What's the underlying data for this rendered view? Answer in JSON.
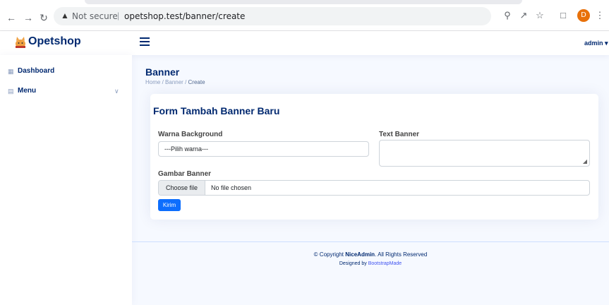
{
  "browser": {
    "security_label": "Not secure",
    "separator": "|",
    "url": "opetshop.test/banner/create",
    "profile_initial": "D",
    "icons": [
      "back-icon",
      "forward-icon",
      "reload-icon",
      "warning-icon",
      "zoom-icon",
      "share-icon",
      "star-icon",
      "sidepanel-icon",
      "menu-dots-icon"
    ]
  },
  "header": {
    "app_name": "Opetshop",
    "user": "admin"
  },
  "sidebar": {
    "items": [
      {
        "label": "Dashboard",
        "icon": "grid-icon"
      },
      {
        "label": "Menu",
        "icon": "menu-list-icon",
        "has_chevron": true
      }
    ]
  },
  "page": {
    "title": "Banner",
    "breadcrumb": [
      "Home",
      "Banner",
      "Create"
    ]
  },
  "form": {
    "title": "Form Tambah Banner Baru",
    "color_label": "Warna Background",
    "color_selected": "---Pilih warna---",
    "text_label": "Text Banner",
    "text_value": "",
    "image_label": "Gambar Banner",
    "file_button": "Choose file",
    "file_status": "No file chosen",
    "submit": "Kirim"
  },
  "footer": {
    "copy_prefix": "© Copyright",
    "brand": "NiceAdmin",
    "copy_suffix": ". All Rights Reserved",
    "designed_by": "Designed by",
    "designer": "BootstrapMade"
  },
  "colors": {
    "primary_navy": "#012970",
    "button_blue": "#0d6efd",
    "link_blue": "#4154f1",
    "background": "#f6f9ff"
  }
}
